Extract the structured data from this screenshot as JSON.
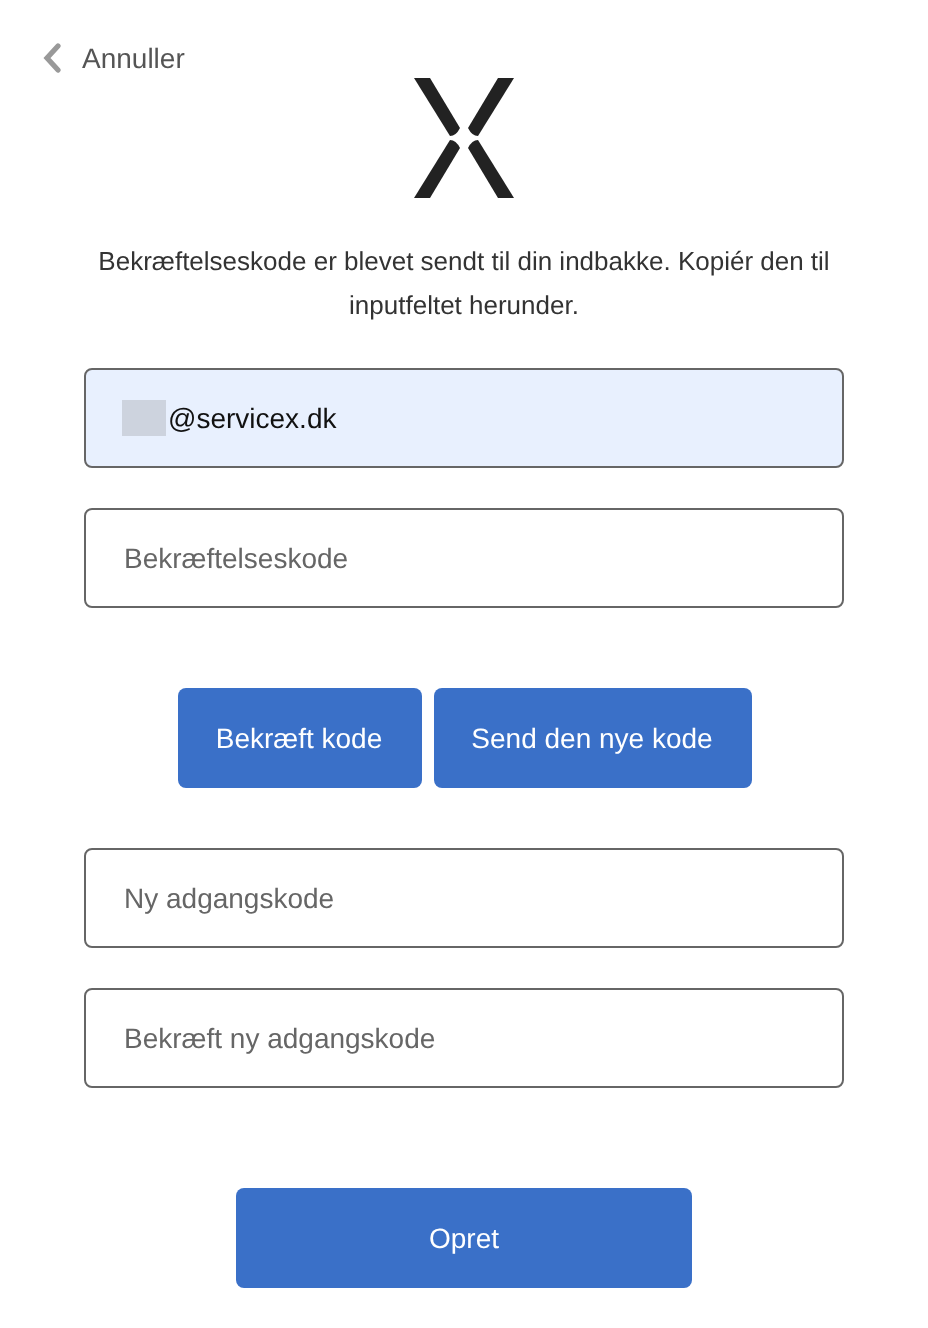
{
  "back_link": {
    "label": "Annuller"
  },
  "message": "Bekræftelseskode er blevet sendt til din indbakke. Kopiér den til inputfeltet herunder.",
  "email_field": {
    "value": "@servicex.dk",
    "autofilled": true,
    "redacted_prefix": true
  },
  "code_field": {
    "placeholder": "Bekræftelseskode"
  },
  "code_buttons": [
    {
      "label": "Bekræft kode"
    },
    {
      "label": "Send den nye kode"
    }
  ],
  "password_fields": [
    {
      "placeholder": "Ny adgangskode"
    },
    {
      "placeholder": "Bekræft ny adgangskode"
    }
  ],
  "submit_button": {
    "label": "Opret"
  }
}
